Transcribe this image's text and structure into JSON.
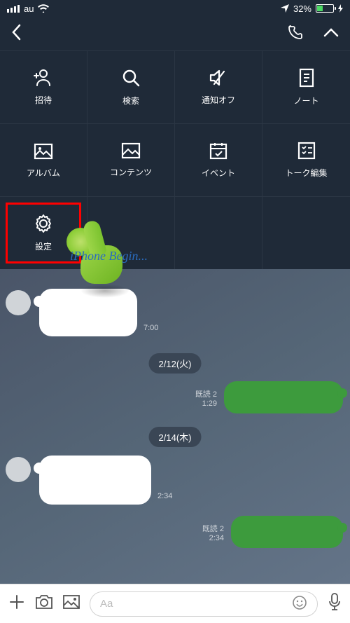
{
  "status": {
    "carrier": "au",
    "battery_pct": "32%"
  },
  "menu": {
    "items": [
      {
        "label": "招待"
      },
      {
        "label": "検索"
      },
      {
        "label": "通知オフ"
      },
      {
        "label": "ノート"
      },
      {
        "label": "アルバム"
      },
      {
        "label": "コンテンツ"
      },
      {
        "label": "イベント"
      },
      {
        "label": "トーク編集"
      },
      {
        "label": "設定"
      }
    ]
  },
  "chat": {
    "msg1_time": "7:00",
    "date1": "2/12(火)",
    "msg2_read": "既読 2",
    "msg2_time": "1:29",
    "date2": "2/14(木)",
    "msg3_time": "2:34",
    "msg4_read": "既読 2",
    "msg4_time": "2:34"
  },
  "input": {
    "placeholder": "Aa"
  }
}
